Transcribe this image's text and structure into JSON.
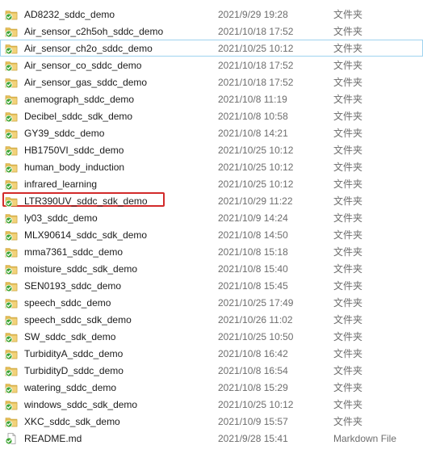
{
  "files": [
    {
      "name": "AD8232_sddc_demo",
      "date": "2021/9/29 19:28",
      "type": "文件夹",
      "icon": "folder-sync-icon"
    },
    {
      "name": "Air_sensor_c2h5oh_sddc_demo",
      "date": "2021/10/18 17:52",
      "type": "文件夹",
      "icon": "folder-sync-icon"
    },
    {
      "name": "Air_sensor_ch2o_sddc_demo",
      "date": "2021/10/25 10:12",
      "type": "文件夹",
      "icon": "folder-sync-icon"
    },
    {
      "name": "Air_sensor_co_sddc_demo",
      "date": "2021/10/18 17:52",
      "type": "文件夹",
      "icon": "folder-sync-icon"
    },
    {
      "name": "Air_sensor_gas_sddc_demo",
      "date": "2021/10/18 17:52",
      "type": "文件夹",
      "icon": "folder-sync-icon"
    },
    {
      "name": "anemograph_sddc_demo",
      "date": "2021/10/8 11:19",
      "type": "文件夹",
      "icon": "folder-sync-icon"
    },
    {
      "name": "Decibel_sddc_sdk_demo",
      "date": "2021/10/8 10:58",
      "type": "文件夹",
      "icon": "folder-sync-icon"
    },
    {
      "name": "GY39_sddc_demo",
      "date": "2021/10/8 14:21",
      "type": "文件夹",
      "icon": "folder-sync-icon"
    },
    {
      "name": "HB1750VI_sddc_demo",
      "date": "2021/10/25 10:12",
      "type": "文件夹",
      "icon": "folder-sync-icon"
    },
    {
      "name": "human_body_induction",
      "date": "2021/10/25 10:12",
      "type": "文件夹",
      "icon": "folder-sync-icon"
    },
    {
      "name": "infrared_learning",
      "date": "2021/10/25 10:12",
      "type": "文件夹",
      "icon": "folder-sync-icon"
    },
    {
      "name": "LTR390UV_sddc_sdk_demo",
      "date": "2021/10/29 11:22",
      "type": "文件夹",
      "icon": "folder-sync-icon"
    },
    {
      "name": "ly03_sddc_demo",
      "date": "2021/10/9 14:24",
      "type": "文件夹",
      "icon": "folder-sync-icon"
    },
    {
      "name": "MLX90614_sddc_sdk_demo",
      "date": "2021/10/8 14:50",
      "type": "文件夹",
      "icon": "folder-sync-icon"
    },
    {
      "name": "mma7361_sddc_demo",
      "date": "2021/10/8 15:18",
      "type": "文件夹",
      "icon": "folder-sync-icon"
    },
    {
      "name": "moisture_sddc_sdk_demo",
      "date": "2021/10/8 15:40",
      "type": "文件夹",
      "icon": "folder-sync-icon"
    },
    {
      "name": "SEN0193_sddc_demo",
      "date": "2021/10/8 15:45",
      "type": "文件夹",
      "icon": "folder-sync-icon"
    },
    {
      "name": "speech_sddc_demo",
      "date": "2021/10/25 17:49",
      "type": "文件夹",
      "icon": "folder-sync-icon"
    },
    {
      "name": "speech_sddc_sdk_demo",
      "date": "2021/10/26 11:02",
      "type": "文件夹",
      "icon": "folder-sync-icon"
    },
    {
      "name": "SW_sddc_sdk_demo",
      "date": "2021/10/25 10:50",
      "type": "文件夹",
      "icon": "folder-sync-icon"
    },
    {
      "name": "TurbidityA_sddc_demo",
      "date": "2021/10/8 16:42",
      "type": "文件夹",
      "icon": "folder-sync-icon"
    },
    {
      "name": "TurbidityD_sddc_demo",
      "date": "2021/10/8 16:54",
      "type": "文件夹",
      "icon": "folder-sync-icon"
    },
    {
      "name": "watering_sddc_demo",
      "date": "2021/10/8 15:29",
      "type": "文件夹",
      "icon": "folder-sync-icon"
    },
    {
      "name": "windows_sddc_sdk_demo",
      "date": "2021/10/25 10:12",
      "type": "文件夹",
      "icon": "folder-sync-icon"
    },
    {
      "name": "XKC_sddc_sdk_demo",
      "date": "2021/10/9 15:57",
      "type": "文件夹",
      "icon": "folder-sync-icon"
    },
    {
      "name": "README.md",
      "date": "2021/9/28 15:41",
      "type": "Markdown File",
      "icon": "file-sync-icon"
    }
  ],
  "hovered_row": "Air_sensor_ch2o_sddc_demo",
  "highlighted_row": "LTR390UV_sddc_sdk_demo",
  "colors": {
    "folder": "#e8c25a",
    "sync_check": "#3fa535",
    "highlight_border": "#d22b2b",
    "hover_border": "#9fd3ef"
  }
}
